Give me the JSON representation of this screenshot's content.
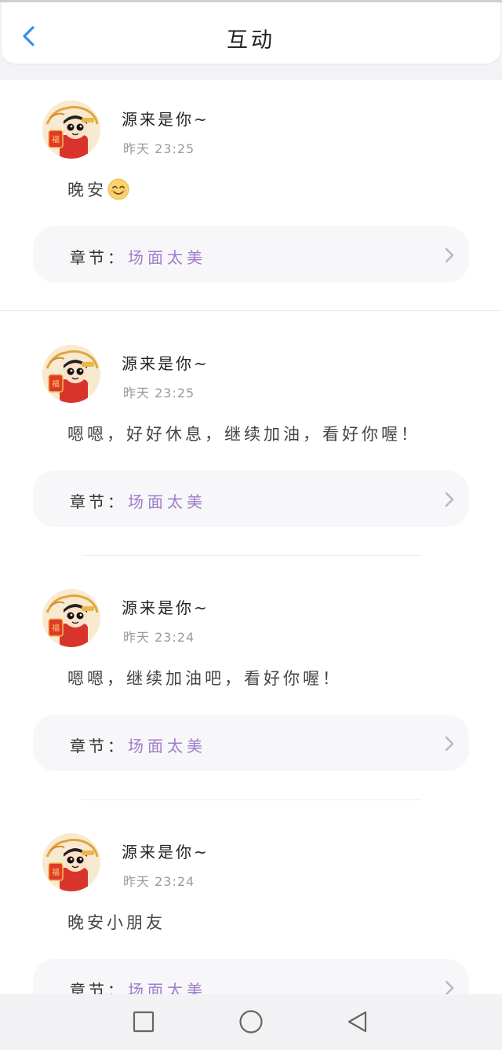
{
  "header": {
    "title": "互动",
    "back_icon": "chevron-left-icon",
    "accent_color": "#3a8ee6"
  },
  "chapter_color": "#a07ccc",
  "items": [
    {
      "username": "源来是你~",
      "timestamp": "昨天 23:25",
      "comment": "晚安",
      "emoji": "smiling-face-icon",
      "chapter_prefix": "章节：",
      "chapter_name": "场面太美"
    },
    {
      "username": "源来是你~",
      "timestamp": "昨天 23:25",
      "comment": "嗯嗯，好好休息，继续加油，看好你喔！",
      "chapter_prefix": "章节：",
      "chapter_name": "场面太美"
    },
    {
      "username": "源来是你~",
      "timestamp": "昨天 23:24",
      "comment": "嗯嗯，继续加油吧，看好你喔！",
      "chapter_prefix": "章节：",
      "chapter_name": "场面太美"
    },
    {
      "username": "源来是你~",
      "timestamp": "昨天 23:24",
      "comment": "晚安小朋友",
      "chapter_prefix": "章节：",
      "chapter_name": "场面太美"
    }
  ],
  "navbar": {
    "recent_icon": "square-icon",
    "home_icon": "circle-icon",
    "back_icon": "triangle-back-icon"
  }
}
